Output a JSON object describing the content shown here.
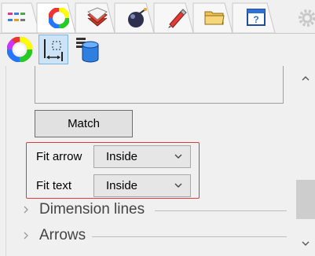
{
  "tabs": [
    {
      "icon": "object-properties-icon"
    },
    {
      "icon": "color-wheel-icon"
    },
    {
      "icon": "layer-icon"
    },
    {
      "icon": "render-icon"
    },
    {
      "icon": "material-edit-icon"
    },
    {
      "icon": "folder-icon"
    },
    {
      "icon": "window-icon"
    },
    {
      "icon": "settings-icon"
    }
  ],
  "subtoolbar": [
    {
      "icon": "color-wheel-icon",
      "active": false
    },
    {
      "icon": "dimension-style-icon",
      "active": true
    },
    {
      "icon": "database-icon",
      "active": false
    }
  ],
  "match_button": {
    "label": "Match"
  },
  "fit_arrow": {
    "label": "Fit arrow",
    "value": "Inside"
  },
  "fit_text": {
    "label": "Fit text",
    "value": "Inside"
  },
  "sections": [
    {
      "label": "Dimension lines",
      "collapsed": true
    },
    {
      "label": "Arrows",
      "collapsed": true
    }
  ],
  "colors": {
    "highlight": "#e0393e",
    "active_tab_bg": "#cde4f7"
  }
}
